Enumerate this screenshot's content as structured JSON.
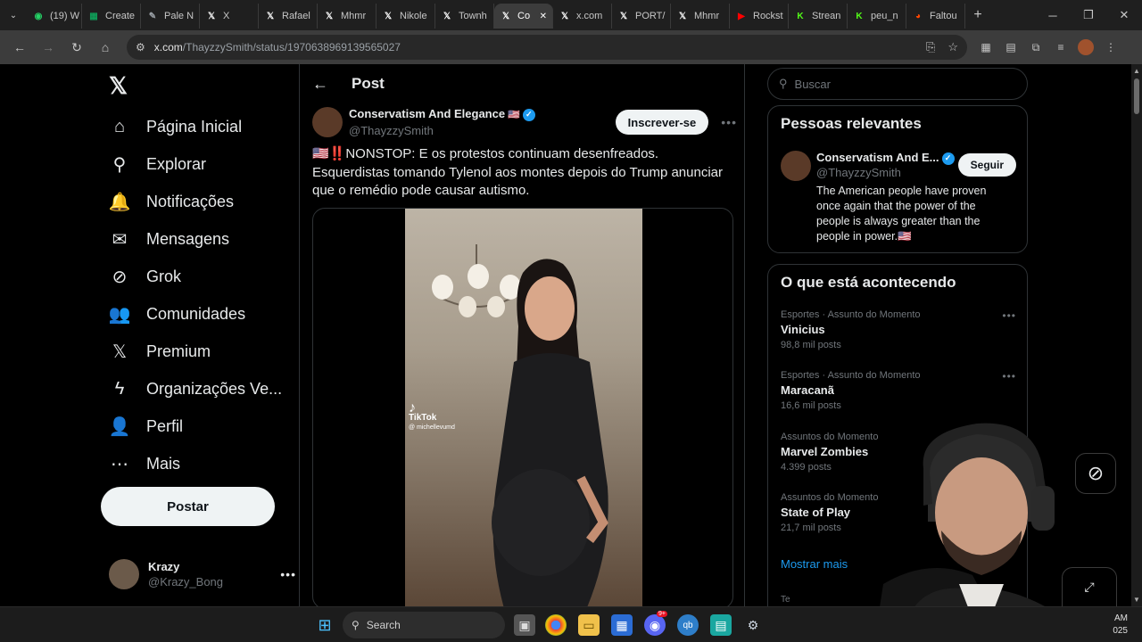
{
  "browser": {
    "tabs": [
      {
        "label": "(19) W",
        "icon": "whatsapp",
        "color": "#25d366"
      },
      {
        "label": "Create",
        "icon": "sheets",
        "color": "#0f9d58"
      },
      {
        "label": "Pale N",
        "icon": "pen",
        "color": "#9aa0a6"
      },
      {
        "label": "X",
        "icon": "x",
        "color": "#ffffff"
      },
      {
        "label": "Rafael",
        "icon": "x",
        "color": "#ffffff"
      },
      {
        "label": "Mhmr",
        "icon": "x",
        "color": "#ffffff"
      },
      {
        "label": "Nikole",
        "icon": "x",
        "color": "#ffffff"
      },
      {
        "label": "Townh",
        "icon": "x",
        "color": "#ffffff"
      },
      {
        "label": "Co",
        "icon": "x",
        "color": "#ffffff",
        "active": true
      },
      {
        "label": "x.com",
        "icon": "x",
        "color": "#ffffff"
      },
      {
        "label": "PORT/",
        "icon": "x",
        "color": "#ffffff"
      },
      {
        "label": "Mhmr",
        "icon": "x",
        "color": "#ffffff"
      },
      {
        "label": "Rockst",
        "icon": "youtube",
        "color": "#ff0000"
      },
      {
        "label": "Strean",
        "icon": "kick",
        "color": "#53fc18"
      },
      {
        "label": "peu_n",
        "icon": "kick",
        "color": "#53fc18"
      },
      {
        "label": "Faltou",
        "icon": "reddit",
        "color": "#ff4500"
      }
    ],
    "url_host": "x.com",
    "url_path": "/ThayzzySmith/status/1970638969139565027"
  },
  "nav": {
    "items": [
      {
        "label": "Página Inicial",
        "icon": "home-icon",
        "glyph": "⌂"
      },
      {
        "label": "Explorar",
        "icon": "search-icon",
        "glyph": "⚲"
      },
      {
        "label": "Notificações",
        "icon": "bell-icon",
        "glyph": "🔔"
      },
      {
        "label": "Mensagens",
        "icon": "envelope-icon",
        "glyph": "✉"
      },
      {
        "label": "Grok",
        "icon": "grok-icon",
        "glyph": "⊘"
      },
      {
        "label": "Comunidades",
        "icon": "communities-icon",
        "glyph": "👥"
      },
      {
        "label": "Premium",
        "icon": "x-premium-icon",
        "glyph": "𝕏"
      },
      {
        "label": "Organizações Ve...",
        "icon": "lightning-icon",
        "glyph": "ϟ"
      },
      {
        "label": "Perfil",
        "icon": "person-icon",
        "glyph": "👤"
      },
      {
        "label": "Mais",
        "icon": "more-circle-icon",
        "glyph": "⋯"
      }
    ],
    "post_label": "Postar",
    "account": {
      "display_name": "Krazy",
      "username": "@Krazy_Bong"
    }
  },
  "main": {
    "header_title": "Post",
    "tweet": {
      "display_name": "Conservatism And Elegance",
      "flag": "🇺🇸",
      "username": "@ThayzzySmith",
      "subscribe_label": "Inscrever-se",
      "text": "🇺🇸‼️NONSTOP: E os protestos continuam desenfreados.  Esquerdistas tomando Tylenol aos montes depois do Trump anunciar que o remédio pode causar autismo.",
      "video_watermark": "TikTok",
      "video_handle": "@ michellevumd"
    }
  },
  "sidebar": {
    "search_placeholder": "Buscar",
    "relevant_title": "Pessoas relevantes",
    "relevant_person": {
      "display_name": "Conservatism And E...",
      "username": "@ThayzzySmith",
      "follow_label": "Seguir",
      "bio": "The American people have proven once again that the power of the people is always greater than the people in power.🇺🇸"
    },
    "trends_title": "O que está acontecendo",
    "trends": [
      {
        "context": "Esportes · Assunto do Momento",
        "name": "Vinicius",
        "count": "98,8 mil posts"
      },
      {
        "context": "Esportes · Assunto do Momento",
        "name": "Maracanã",
        "count": "16,6 mil posts"
      },
      {
        "context": "Assuntos do Momento",
        "name": "Marvel Zombies",
        "count": "4.399 posts"
      },
      {
        "context": "Assuntos do Momento",
        "name": "State of Play",
        "count": "21,7 mil posts"
      }
    ],
    "show_more": "Mostrar mais",
    "peek_text": "Te"
  },
  "taskbar": {
    "search_label": "Search",
    "discord_badge": "9+",
    "clock_time": "AM",
    "clock_date": "025"
  }
}
